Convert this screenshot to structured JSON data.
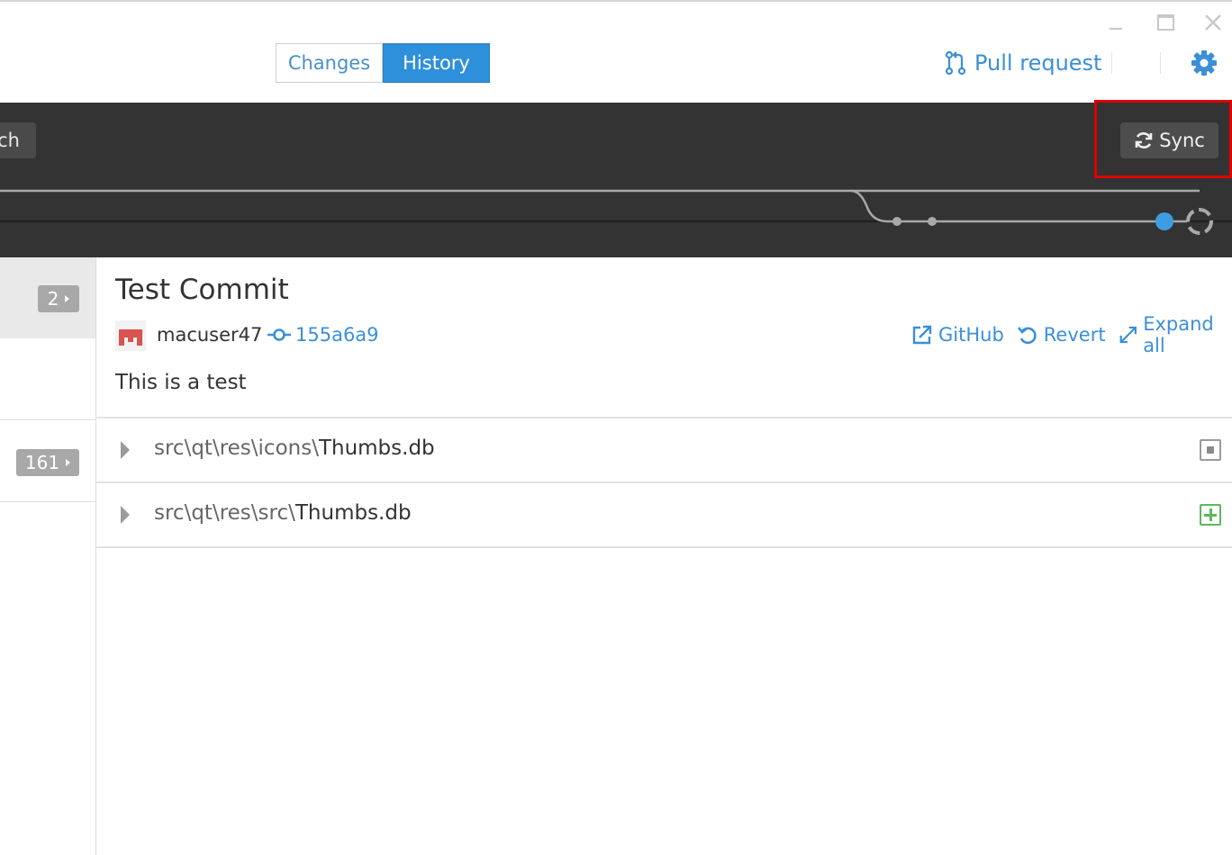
{
  "window": {
    "minimize_icon": "minimize-icon",
    "maximize_icon": "maximize-icon",
    "close_icon": "close-icon"
  },
  "header": {
    "tabs": [
      {
        "label": "Changes",
        "active": false
      },
      {
        "label": "History",
        "active": true
      }
    ],
    "pull_request_label": "Pull request",
    "pull_request_icon": "pull-request-icon",
    "settings_icon": "gear-icon"
  },
  "toolbar": {
    "branch_label_partial": "ch",
    "sync_label": "Sync",
    "sync_icon": "sync-icon"
  },
  "sidebar": {
    "badges": [
      "2",
      "161"
    ]
  },
  "commit": {
    "title": "Test Commit",
    "author": "macuser47",
    "sha": "155a6a9",
    "message": "This is a test",
    "actions": [
      {
        "label": "GitHub",
        "icon": "external-link-icon"
      },
      {
        "label": "Revert",
        "icon": "revert-icon"
      },
      {
        "label": "Expand all",
        "icon": "expand-icon"
      }
    ]
  },
  "files": [
    {
      "dir": "src\\qt\\res\\icons\\",
      "name": "Thumbs.db",
      "status": "modified",
      "status_icon": "file-modified-icon"
    },
    {
      "dir": "src\\qt\\res\\src\\",
      "name": "Thumbs.db",
      "status": "added",
      "status_icon": "file-added-icon"
    }
  ],
  "colors": {
    "accent": "#2e8fdb",
    "link": "#3b8fd8",
    "toolbar_bg": "#333333",
    "highlight": "#e00000",
    "added": "#5cb85c"
  }
}
